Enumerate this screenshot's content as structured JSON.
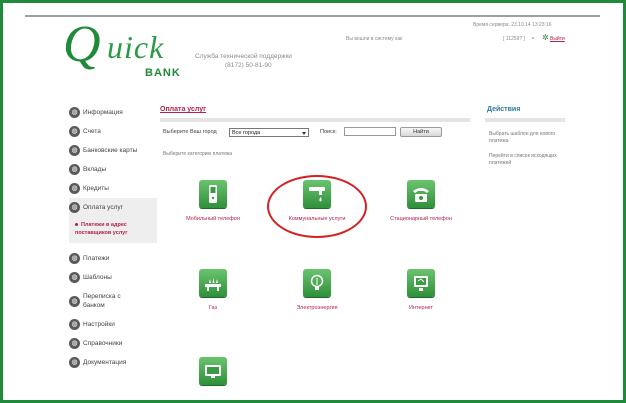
{
  "header": {
    "server_time": "Время сервера: 23.10.14 13:23:16",
    "login_as": "Вы вошли в систему как",
    "user_id": "[ 11259? ]",
    "logout": "Выйти",
    "support_title": "Служба технической поддержки",
    "support_phone": "(8172) 50-81-90"
  },
  "logo": {
    "q": "Q",
    "uick": "uick",
    "bank": "BANK"
  },
  "sidebar": {
    "items": [
      {
        "label": "Информация",
        "icon": "globe-icon"
      },
      {
        "label": "Счета",
        "icon": "globe-icon"
      },
      {
        "label": "Банковские карты",
        "icon": "globe-icon"
      },
      {
        "label": "Вклады",
        "icon": "globe-icon"
      },
      {
        "label": "Кредиты",
        "icon": "globe-icon"
      },
      {
        "label": "Оплата услуг",
        "icon": "globe-icon"
      },
      {
        "label": "Платежи",
        "icon": "globe-icon"
      },
      {
        "label": "Шаблоны",
        "icon": "globe-icon"
      },
      {
        "label": "Переписка с банком",
        "icon": "globe-icon"
      },
      {
        "label": "Настройки",
        "icon": "globe-icon"
      },
      {
        "label": "Справочники",
        "icon": "globe-icon"
      },
      {
        "label": "Документация",
        "icon": "globe-icon"
      }
    ],
    "sub_item": "Платежи в адрес поставщиков услуг"
  },
  "main": {
    "title": "Оплата услуг",
    "city_label": "Выберите Ваш город",
    "city_value": "Все города",
    "search_label": "Поиск:",
    "search_value": "",
    "find_button": "Найти",
    "category_label": "Выберите категорию платежа",
    "tiles": [
      {
        "label": "Мобильный телефон",
        "icon": "mobile-phone-icon"
      },
      {
        "label": "Коммунальные услуги",
        "icon": "water-tap-icon"
      },
      {
        "label": "Стационарный телефон",
        "icon": "landline-phone-icon"
      },
      {
        "label": "Газ",
        "icon": "gas-stove-icon"
      },
      {
        "label": "Электроэнергия",
        "icon": "light-bulb-icon"
      },
      {
        "label": "Интернет",
        "icon": "internet-monitor-icon"
      },
      {
        "label": "",
        "icon": "tv-icon"
      }
    ]
  },
  "actions": {
    "title": "Действия",
    "links": [
      "Выбрать шаблон для нового платежа",
      "Перейти в список исходящих платежей"
    ]
  },
  "colors": {
    "brand_green": "#1f8a3a",
    "link_red": "#b2224a",
    "highlight_red": "#d22222"
  }
}
